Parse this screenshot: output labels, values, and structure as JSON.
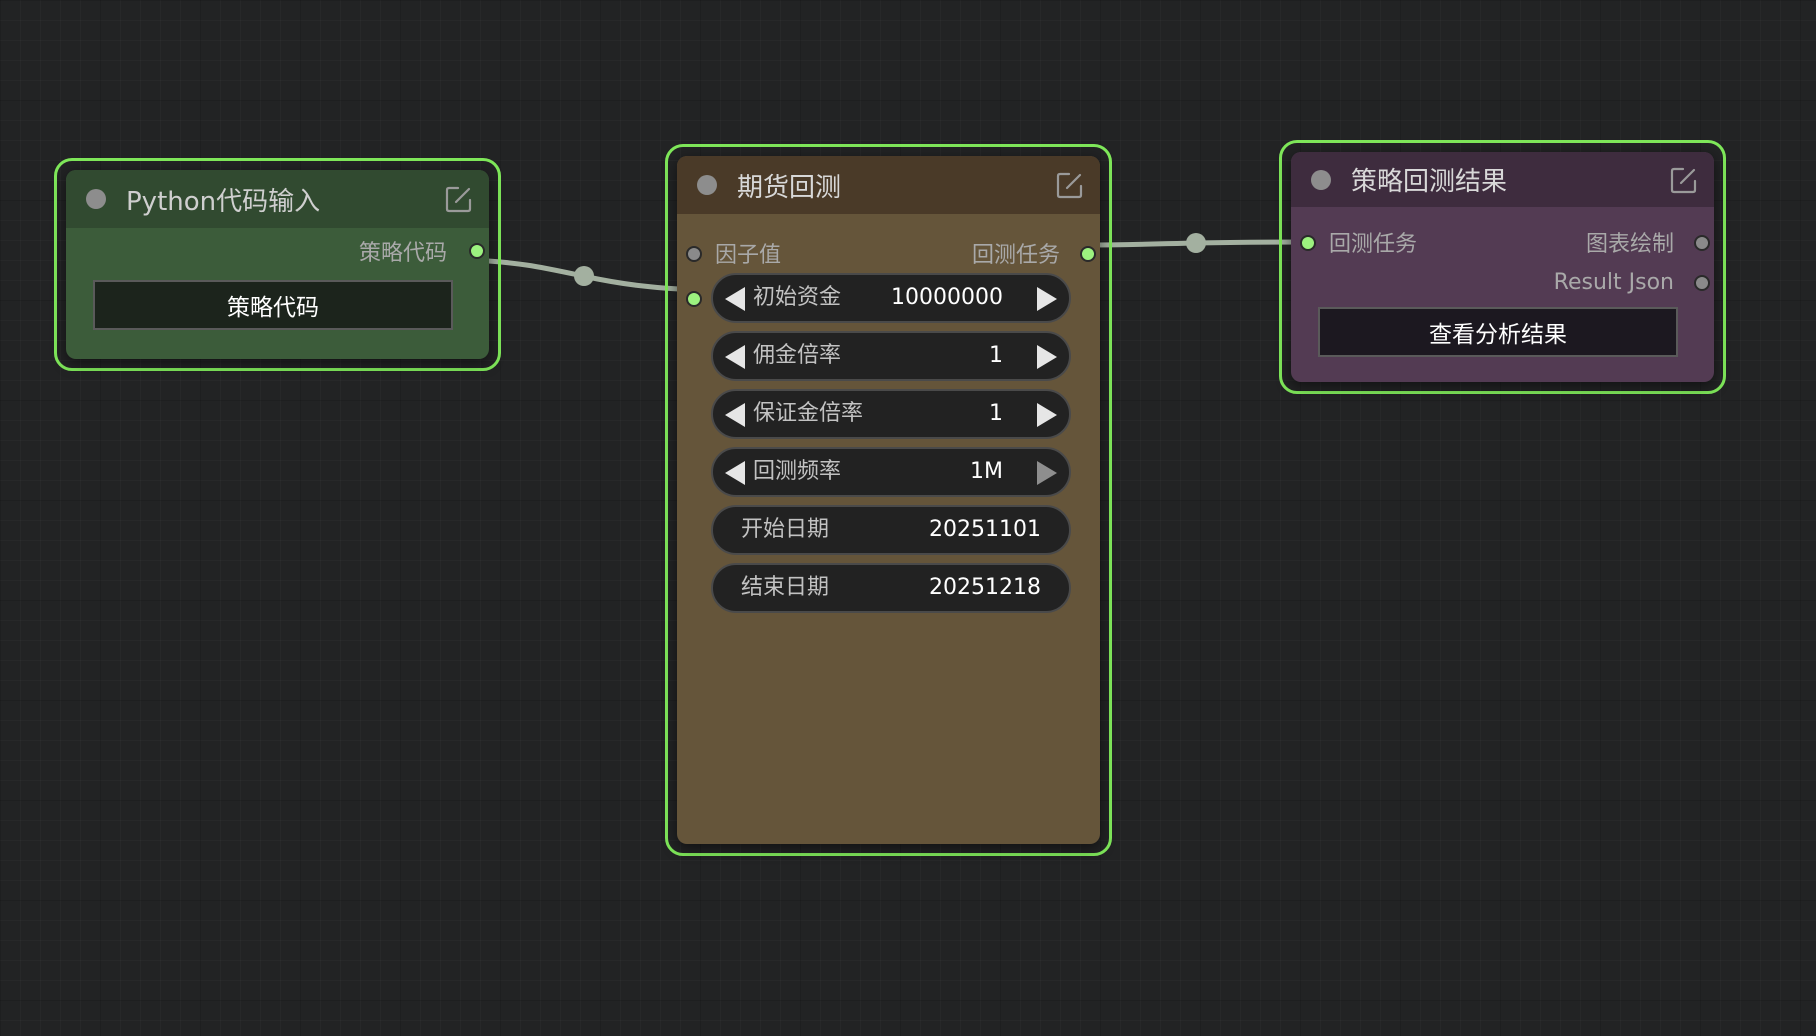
{
  "nodes": {
    "python_input": {
      "title": "Python代码输入",
      "output_label": "策略代码",
      "button_label": "策略代码",
      "colors": {
        "header": "#314a30",
        "body": "#3c5c3a",
        "button": "#1c241c"
      }
    },
    "futures_backtest": {
      "title": "期货回测",
      "input_label": "因子值",
      "output_label": "回测任务",
      "widgets": [
        {
          "label": "初始资金",
          "value": "10000000"
        },
        {
          "label": "佣金倍率",
          "value": "1"
        },
        {
          "label": "保证金倍率",
          "value": "1"
        },
        {
          "label": "回测频率",
          "value": "1M"
        },
        {
          "label": "开始日期",
          "value": "20251101"
        },
        {
          "label": "结束日期",
          "value": "20251218"
        }
      ],
      "colors": {
        "header": "#4a3a28",
        "body": "#65553a"
      }
    },
    "backtest_result": {
      "title": "策略回测结果",
      "input_label": "回测任务",
      "outputs": [
        "图表绘制",
        "Result Json"
      ],
      "button_label": "查看分析结果",
      "colors": {
        "header": "#3e2c3e",
        "body": "#533b53",
        "button": "#1c1820"
      }
    }
  },
  "colors": {
    "canvas": "#222324",
    "selection": "#7fe85a",
    "link": "#a3b0a0",
    "slot_connected": "#9cf27f",
    "slot_empty": "#8a8a8a"
  }
}
